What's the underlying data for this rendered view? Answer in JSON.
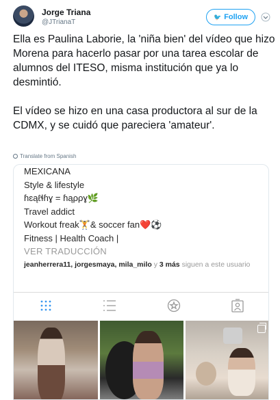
{
  "author": {
    "name": "Jorge Triana",
    "handle": "@JTrianaT"
  },
  "follow_button": {
    "label": "Follow"
  },
  "tweet": {
    "paragraph1": "Ella es Paulina Laborie, la 'niña bien' del vídeo que hizo Morena para hacerlo pasar por una tarea escolar de alumnos del ITESO, misma institución que ya lo desmintió.",
    "paragraph2": "El vídeo se hizo en una casa productora al sur de la CDMX, y se cuidó que pareciera 'amateur'."
  },
  "translate": {
    "label": "Translate from Spanish"
  },
  "instagram": {
    "bio_lines": [
      "MEXICANA",
      "Style & lifestyle",
      "ɦɛąℓɬɦɣ = ɦąρρɣ🌿",
      "Travel addict",
      "Workout freak🏋️& soccer fan❤️⚽",
      "Fitness | Health Coach |"
    ],
    "see_translation": "VER TRADUCCIÓN",
    "followers": {
      "names": "jeanherrera11, jorgesmaya, mila_milo",
      "connector": " y ",
      "more": "3 más",
      "suffix": " siguen a este usuario"
    },
    "tabs": [
      "grid-icon",
      "list-icon",
      "tagged-icon",
      "saved-icon"
    ]
  },
  "colors": {
    "twitter_blue": "#1da1f2",
    "text": "#14171a",
    "muted": "#657786"
  }
}
